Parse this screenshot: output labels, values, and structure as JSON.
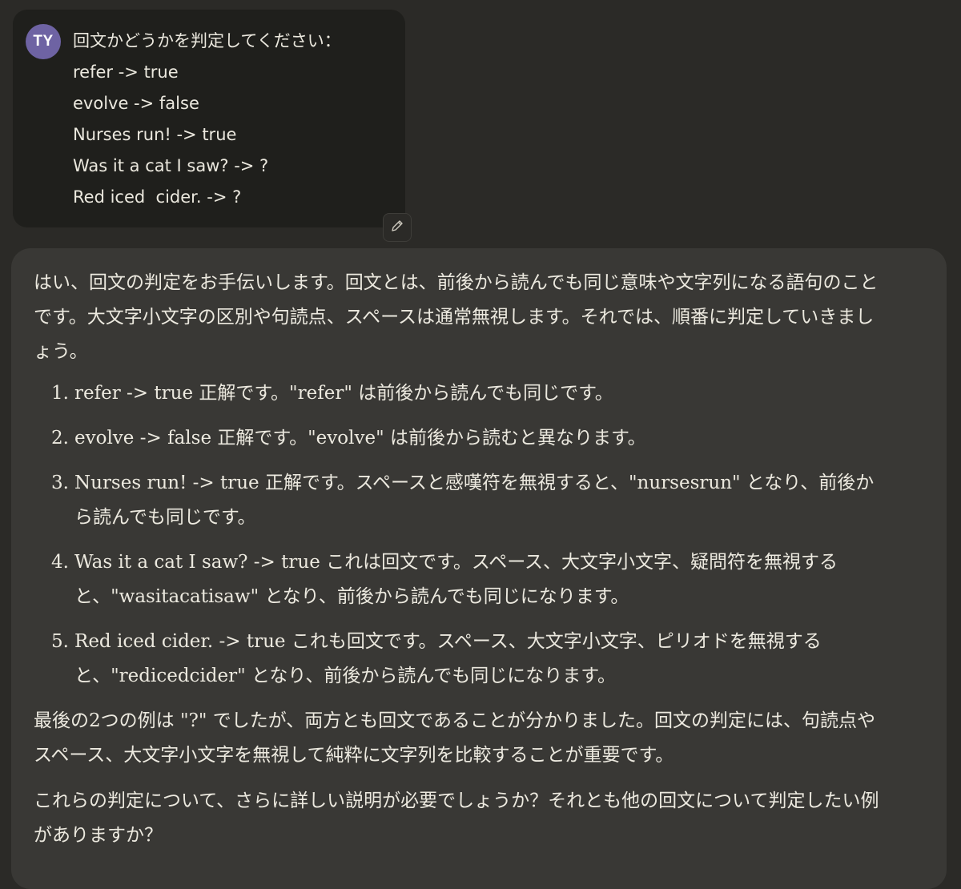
{
  "user_message": {
    "avatar_initials": "TY",
    "lines": [
      "回文かどうかを判定してください：",
      "refer -> true",
      "evolve -> false",
      "Nurses run! -> true",
      "Was it a cat I saw? -> ?",
      "Red iced  cider. -> ?"
    ],
    "edit_icon": "pencil-icon"
  },
  "assistant_message": {
    "intro": "はい、回文の判定をお手伝いします。回文とは、前後から読んでも同じ意味や文字列になる語句のことです。大文字小文字の区別や句読点、スペースは通常無視します。それでは、順番に判定していきましょう。",
    "items": [
      {
        "num": "1.",
        "text": "refer -> true 正解です。\"refer\" は前後から読んでも同じです。"
      },
      {
        "num": "2.",
        "text": "evolve -> false 正解です。\"evolve\" は前後から読むと異なります。"
      },
      {
        "num": "3.",
        "text": "Nurses run! -> true 正解です。スペースと感嘆符を無視すると、\"nursesrun\" となり、前後から読んでも同じです。"
      },
      {
        "num": "4.",
        "text": "Was it a cat I saw? -> true これは回文です。スペース、大文字小文字、疑問符を無視すると、\"wasitacatisaw\" となり、前後から読んでも同じになります。"
      },
      {
        "num": "5.",
        "text": "Red iced cider. -> true これも回文です。スペース、大文字小文字、ピリオドを無視すると、\"redicedcider\" となり、前後から読んでも同じになります。"
      }
    ],
    "summary": "最後の2つの例は \"?\" でしたが、両方とも回文であることが分かりました。回文の判定には、句読点やスペース、大文字小文字を無視して純粋に文字列を比較することが重要です。",
    "question": "これらの判定について、さらに詳しい説明が必要でしょうか？それとも他の回文について判定したい例がありますか？"
  },
  "colors": {
    "background": "#2b2a27",
    "user_bubble": "#1f1f1c",
    "assistant_bubble": "#393835",
    "avatar": "#6e63a3",
    "text": "#ece9df"
  }
}
